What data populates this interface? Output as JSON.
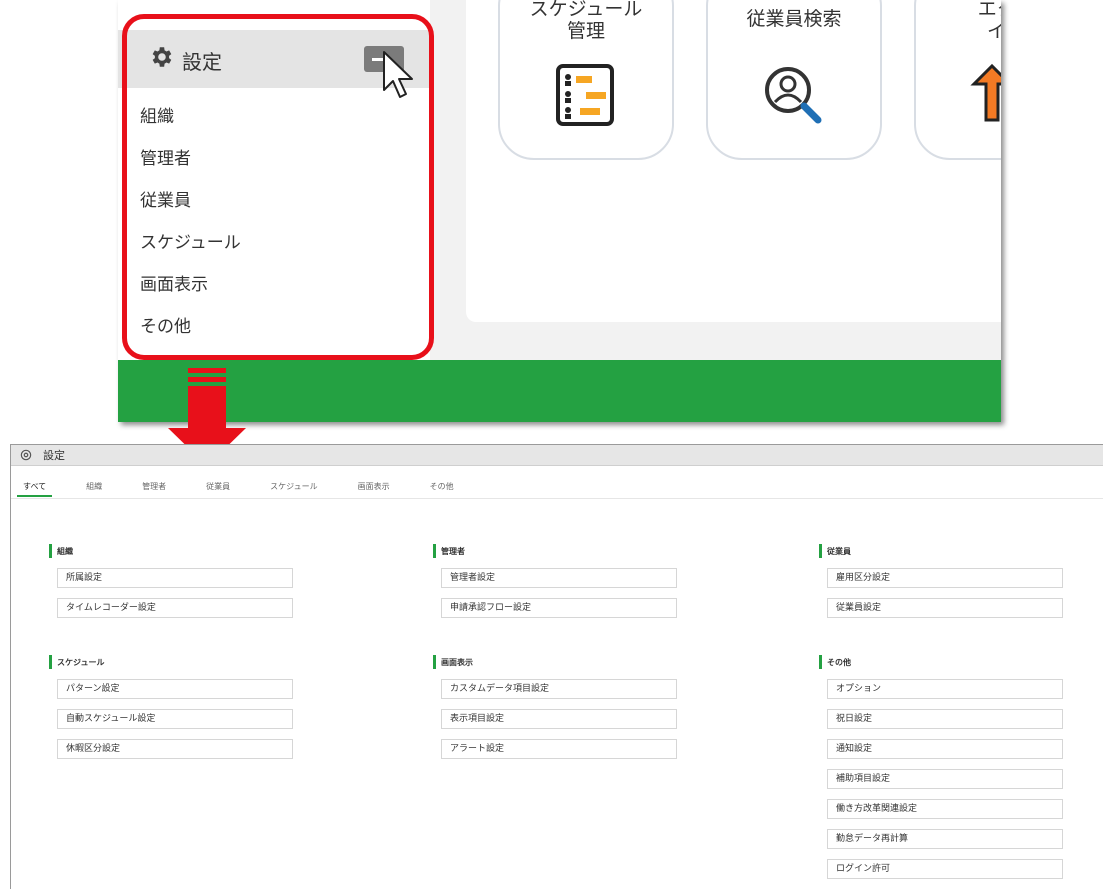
{
  "zoom": {
    "sidebar": {
      "title": "設定",
      "items": [
        "組織",
        "管理者",
        "従業員",
        "スケジュール",
        "画面表示",
        "その他"
      ]
    },
    "tiles": [
      {
        "label": "スケジュール\n管理",
        "icon": "schedule-chart-icon"
      },
      {
        "label": "従業員検索",
        "icon": "employee-search-icon"
      },
      {
        "label": "エクス\nイン",
        "icon": "orange-up-arrow-icon"
      }
    ],
    "colors": {
      "outline": "#e8101a",
      "accent": "#24a142"
    }
  },
  "page": {
    "title": "設定",
    "tabs": [
      "すべて",
      "組織",
      "管理者",
      "従業員",
      "スケジュール",
      "画面表示",
      "その他"
    ],
    "active_tab": "すべて",
    "sections": [
      {
        "title": "組織",
        "items": [
          "所属設定",
          "タイムレコーダー設定"
        ]
      },
      {
        "title": "管理者",
        "items": [
          "管理者設定",
          "申請承認フロー設定"
        ]
      },
      {
        "title": "従業員",
        "items": [
          "雇用区分設定",
          "従業員設定"
        ]
      },
      {
        "title": "スケジュール",
        "items": [
          "パターン設定",
          "自動スケジュール設定",
          "休暇区分設定"
        ]
      },
      {
        "title": "画面表示",
        "items": [
          "カスタムデータ項目設定",
          "表示項目設定",
          "アラート設定"
        ]
      },
      {
        "title": "その他",
        "items": [
          "オプション",
          "祝日設定",
          "通知設定",
          "補助項目設定",
          "働き方改革関連設定",
          "勤怠データ再計算",
          "ログイン許可"
        ]
      }
    ]
  }
}
